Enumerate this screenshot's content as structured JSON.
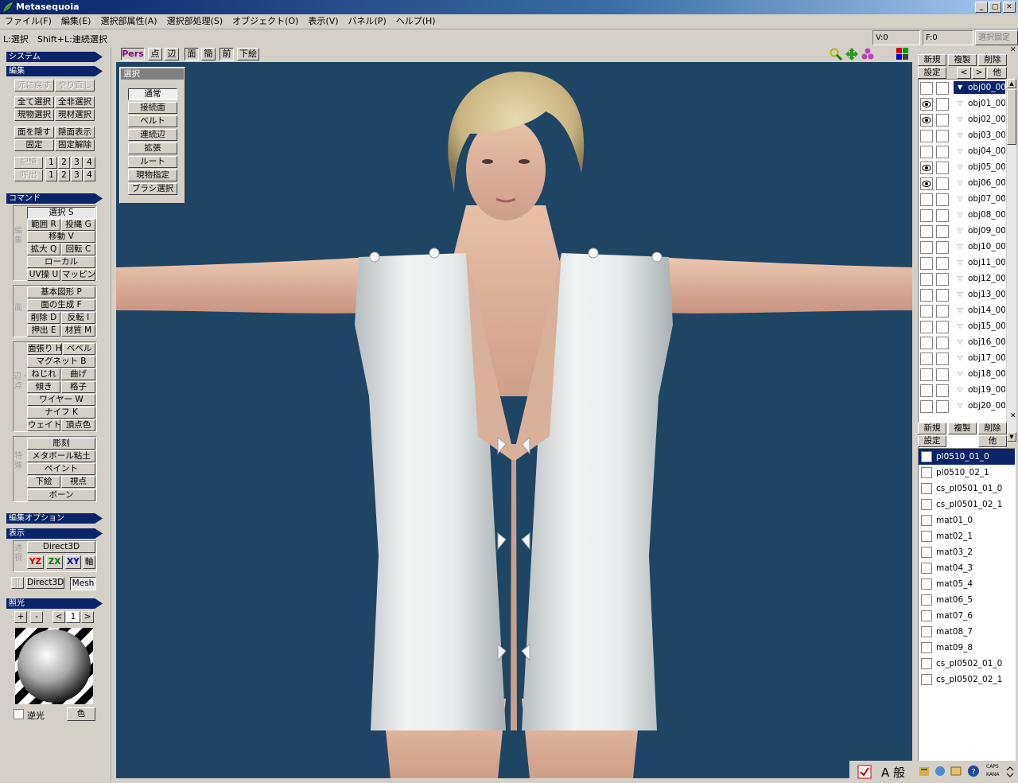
{
  "title": "Metasequoia",
  "winbtns": [
    "_",
    "▢",
    "✕"
  ],
  "menu": [
    "ファイル(F)",
    "編集(E)",
    "選択部属性(A)",
    "選択部処理(S)",
    "オブジェクト(O)",
    "表示(V)",
    "パネル(P)",
    "ヘルプ(H)"
  ],
  "status": {
    "hint": "L:選択　Shift+L:連続選択",
    "v": "V:0",
    "f": "F:0",
    "fix": "選択固定"
  },
  "left": {
    "system": "システム",
    "edit": "編集",
    "undo": "元に戻す",
    "redo": "やり直し",
    "selall": "全て選択",
    "deselall": "全非選択",
    "selobj": "現物選択",
    "selmat": "現材選択",
    "hideface": "面を隠す",
    "showface": "隠面表示",
    "fix": "固定",
    "unfix": "固定解除",
    "memory": "記憶",
    "recall": "呼出",
    "nums": [
      "1",
      "2",
      "3",
      "4"
    ],
    "command": "コマンド",
    "g1": "編集",
    "g2": "面",
    "g3": "辺・点",
    "g4": "特殊",
    "cmd_select": "選択 S",
    "cmd_range": "範囲 R",
    "cmd_lasso": "投縄 G",
    "cmd_move": "移動 V",
    "cmd_scale": "拡大 Q",
    "cmd_rotate": "回転 C",
    "cmd_local": "ローカル",
    "cmd_uv": "UV操 U",
    "cmd_mapping": "マッピング",
    "cmd_prim": "基本図形 P",
    "cmd_facegen": "面の生成 F",
    "cmd_delete": "削除 D",
    "cmd_flip": "反転 I",
    "cmd_extrude": "押出 E",
    "cmd_material": "材質 M",
    "cmd_bevelface": "面張り H",
    "cmd_bevel": "ベベル",
    "cmd_magnet": "マグネット B",
    "cmd_twist": "ねじれ",
    "cmd_bend": "曲げ",
    "cmd_tilt": "傾き",
    "cmd_lattice": "格子",
    "cmd_wire": "ワイヤー W",
    "cmd_knife": "ナイフ K",
    "cmd_weight": "ウェイト",
    "cmd_vcolor": "頂点色",
    "cmd_sculpt": "彫刻",
    "cmd_metaball": "メタボール粘土",
    "cmd_paint": "ペイント",
    "cmd_underlay": "下絵",
    "cmd_viewpoint": "視点",
    "cmd_bone": "ボーン",
    "editopt": "編集オプション",
    "display": "表示",
    "persp": "透視",
    "d3d": "Direct3D",
    "yz": "YZ",
    "zx": "ZX",
    "xy": "XY",
    "axis": "軸",
    "d3d2": "Direct3D",
    "mesh": "Mesh",
    "light": "照光",
    "plus": "+",
    "minus": "-",
    "lt": "<",
    "lightnum": "1",
    "gt": ">",
    "backlight": "逆光",
    "color": "色"
  },
  "viewport": {
    "tabs": [
      "Pers",
      "点",
      "辺",
      "面",
      "簡",
      "前",
      "下絵"
    ],
    "selpanel": {
      "title": "選択",
      "items": [
        "通常",
        "接続面",
        "ベルト",
        "連続辺",
        "拡張",
        "ルート",
        "現物指定",
        "ブラシ選択"
      ]
    }
  },
  "objects": {
    "new": "新規",
    "dup": "複製",
    "del": "削除",
    "settings": "設定",
    "prev": "<",
    "next": ">",
    "other": "他",
    "items": [
      "obj00_00",
      "obj01_00",
      "obj02_00",
      "obj03_00",
      "obj04_00",
      "obj05_00",
      "obj06_00",
      "obj07_00",
      "obj08_00",
      "obj09_00",
      "obj10_00",
      "obj11_00",
      "obj12_00",
      "obj13_00",
      "obj14_00",
      "obj15_00",
      "obj16_00",
      "obj17_00",
      "obj18_00",
      "obj19_00",
      "obj20_00"
    ],
    "visible": [
      false,
      true,
      true,
      false,
      false,
      true,
      true,
      false,
      false,
      false,
      false,
      false,
      false,
      false,
      false,
      false,
      false,
      false,
      false,
      false,
      false
    ]
  },
  "materials": {
    "new": "新規",
    "dup": "複製",
    "del": "削除",
    "settings": "設定",
    "other": "他",
    "items": [
      "pl0510_01_0",
      "pl0510_02_1",
      "cs_pl0501_01_0",
      "cs_pl0501_02_1",
      "mat01_0",
      "mat02_1",
      "mat03_2",
      "mat04_3",
      "mat05_4",
      "mat06_5",
      "mat07_6",
      "mat08_7",
      "mat09_8",
      "cs_pl0502_01_0",
      "cs_pl0502_02_1"
    ]
  },
  "tray": {
    "ime": "A 般",
    "caps": "CAPS",
    "kana": "KANA"
  }
}
